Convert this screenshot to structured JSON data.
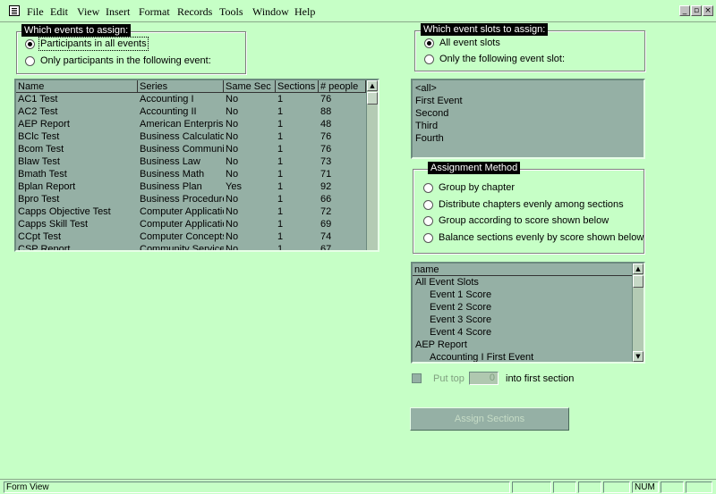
{
  "menubar": {
    "items": [
      "File",
      "Edit",
      "View",
      "Insert",
      "Format",
      "Records",
      "Tools",
      "Window",
      "Help"
    ],
    "window_buttons": [
      "_",
      "▫",
      "×"
    ]
  },
  "events_group": {
    "title": "Which events to assign:",
    "options": [
      "Participants in all events",
      "Only participants in the following event:"
    ],
    "selected": 0
  },
  "events_grid": {
    "columns": [
      "Name",
      "Series",
      "Same Sec",
      "Sections",
      "# people"
    ],
    "rows": [
      [
        "AC1 Test",
        "Accounting I",
        "No",
        "1",
        "76"
      ],
      [
        "AC2 Test",
        "Accounting II",
        "No",
        "1",
        "88"
      ],
      [
        "AEP Report",
        "American Enterprise",
        "No",
        "1",
        "48"
      ],
      [
        "BClc Test",
        "Business Calculation",
        "No",
        "1",
        "76"
      ],
      [
        "Bcom Test",
        "Business Communication",
        "No",
        "1",
        "76"
      ],
      [
        "Blaw Test",
        "Business Law",
        "No",
        "1",
        "73"
      ],
      [
        "Bmath Test",
        "Business Math",
        "No",
        "1",
        "71"
      ],
      [
        "Bplan Report",
        "Business Plan",
        "Yes",
        "1",
        "92"
      ],
      [
        "Bpro Test",
        "Business Procedures",
        "No",
        "1",
        "66"
      ],
      [
        "Capps Objective Test",
        "Computer Applications",
        "No",
        "1",
        "72"
      ],
      [
        "Capps Skill Test",
        "Computer Applications",
        "No",
        "1",
        "69"
      ],
      [
        "CCpt Test",
        "Computer Concepts",
        "No",
        "1",
        "74"
      ],
      [
        "CSP Report",
        "Community Service",
        "No",
        "1",
        "67"
      ]
    ]
  },
  "slots_group": {
    "title": "Which event slots to assign:",
    "options": [
      "All event slots",
      "Only the following event slot:"
    ],
    "selected": 0
  },
  "slots_list": [
    "<all>",
    "First Event",
    "Second",
    "Third",
    "Fourth"
  ],
  "method_group": {
    "title": "Assignment Method",
    "options": [
      "Group by chapter",
      "Distribute chapters evenly among sections",
      "Group according to score shown below",
      "Balance sections evenly by score shown below"
    ]
  },
  "score_list": {
    "header": "name",
    "items": [
      {
        "text": "All Event Slots",
        "indent": 0
      },
      {
        "text": "Event 1 Score",
        "indent": 1
      },
      {
        "text": "Event 2 Score",
        "indent": 1
      },
      {
        "text": "Event 3 Score",
        "indent": 1
      },
      {
        "text": "Event 4 Score",
        "indent": 1
      },
      {
        "text": "AEP Report",
        "indent": 0
      },
      {
        "text": "Accounting I First Event",
        "indent": 1
      }
    ]
  },
  "put_top": {
    "label_before": "Put top",
    "value": "0",
    "label_after": "into first section"
  },
  "assign_button": "Assign Sections",
  "statusbar": {
    "text": "Form View",
    "num": "NUM"
  }
}
